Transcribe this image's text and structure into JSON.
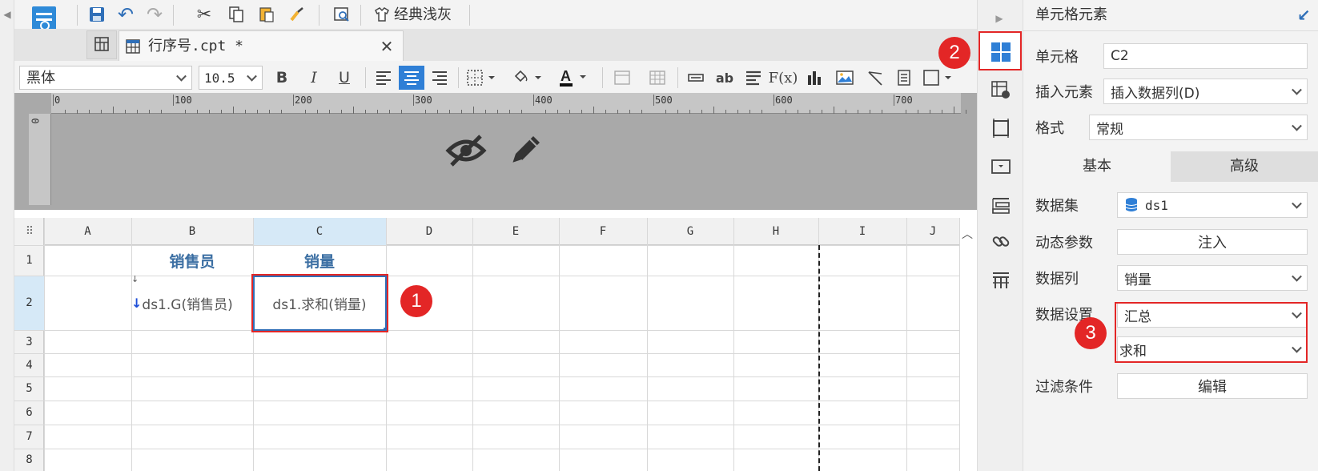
{
  "toolbar": {
    "theme_label": "经典浅灰"
  },
  "tab": {
    "title": "行序号.cpt *"
  },
  "format_bar": {
    "font_name": "黑体",
    "font_size": "10.5",
    "bold": "B",
    "italic": "I",
    "underline": "U",
    "ab": "ab",
    "fx": "F(x)"
  },
  "ruler": {
    "ticks": [
      "0",
      "100",
      "200",
      "300",
      "400",
      "500",
      "600",
      "700"
    ],
    "vertical": "0"
  },
  "sheet": {
    "columns": [
      "A",
      "B",
      "C",
      "D",
      "E",
      "F",
      "G",
      "H",
      "I",
      "J"
    ],
    "rows": [
      "1",
      "2",
      "3",
      "4",
      "5",
      "6",
      "7",
      "8"
    ],
    "cells": {
      "B1": "销售员",
      "C1": "销量",
      "B2": "ds1.G(销售员)",
      "C2": "ds1.求和(销量)"
    }
  },
  "annotations": [
    "1",
    "2",
    "3"
  ],
  "panel": {
    "title": "单元格元素",
    "cell_label": "单元格",
    "cell_value": "C2",
    "insert_label": "插入元素",
    "insert_value": "插入数据列(D)",
    "format_label": "格式",
    "format_value": "常规",
    "tab_basic": "基本",
    "tab_advanced": "高级",
    "dataset_label": "数据集",
    "dataset_value": "ds1",
    "dynparam_label": "动态参数",
    "dynparam_btn": "注入",
    "column_label": "数据列",
    "column_value": "销量",
    "datasetting_label": "数据设置",
    "datasetting_value1": "汇总",
    "datasetting_value2": "求和",
    "filter_label": "过滤条件",
    "filter_btn": "编辑"
  },
  "colors": {
    "accent": "#2f6fb8",
    "annotation_red": "#e32626",
    "header_blue": "#d6e9f7"
  }
}
